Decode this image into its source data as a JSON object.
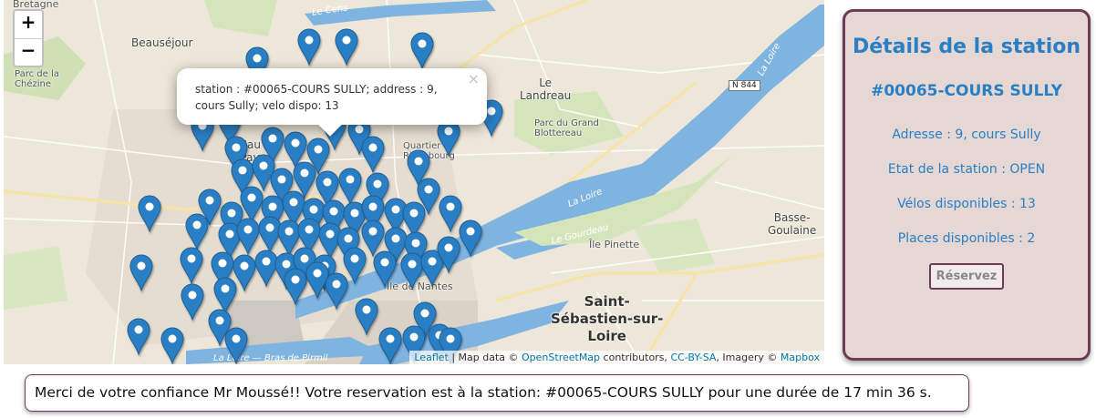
{
  "map": {
    "zoom_in_label": "+",
    "zoom_out_label": "−",
    "places": {
      "bretagne": "Bretagne",
      "beausejour": "Beauséjour",
      "parc_chezine": "Parc de la\nChézine",
      "le_landreau": "Le\nLandreau",
      "parc_grand_blottereau": "Parc du Grand\nBlottereau",
      "quartier_richebourg": "Quartier\nRichebourg",
      "basse_goulaine": "Basse-\nGoulaine",
      "ile_pinette": "Île Pinette",
      "saint_sebastien": "Saint-\nSébastien-sur-\nLoire",
      "haut_pave": "Hau\nPav",
      "ile_de_nantes": "Île de Nantes"
    },
    "water": {
      "le_cens": "Le Cens",
      "la_loire_1": "La Loire",
      "la_loire_2": "La Loire",
      "le_gourdeau": "Le Gourdeau",
      "bras_de_pirmil": "La Loire — Bras de Pirmil"
    },
    "road_shield": "N 844",
    "popup": {
      "text": "station : #00065-COURS SULLY; address : 9, cours Sully; velo dispo: 13",
      "close_label": "×"
    },
    "attribution": {
      "leaflet": "Leaflet",
      "sep1": " | Map data © ",
      "osm": "OpenStreetMap",
      "sep2": " contributors, ",
      "license": "CC-BY-SA",
      "sep3": ", Imagery © ",
      "mapbox": "Mapbox"
    },
    "marker_color": "#2a7fc4",
    "water_color": "#7fb3e0"
  },
  "panel": {
    "title": "Détails de la station",
    "station_name": "#00065-COURS SULLY",
    "address": "Adresse : 9, cours Sully",
    "status": "Etat de la station : OPEN",
    "bikes_available": "Vélos disponibles : 13",
    "places_available": "Places disponibles : 2",
    "reserve_button": "Réservez"
  },
  "confirmation": {
    "text": "Merci de votre confiance Mr Moussé!! Votre reservation est à la station: #00065-COURS SULLY pour une durée de 17 min 36 s."
  }
}
